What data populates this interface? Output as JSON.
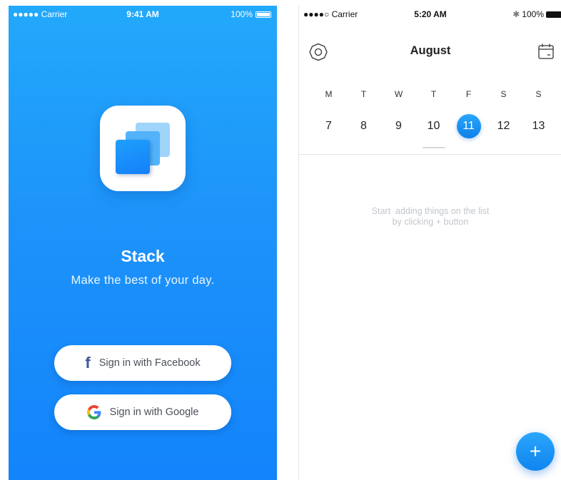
{
  "login_screen": {
    "status_bar": {
      "carrier": "●●●●● Carrier",
      "time": "9:41 AM",
      "battery": "100%"
    },
    "app_name": "Stack",
    "tagline": "Make the best of your day.",
    "facebook_button": {
      "label": "Sign in with Facebook",
      "icon": "facebook-icon"
    },
    "google_button": {
      "label": "Sign in with Google",
      "icon": "google-icon"
    },
    "colors": {
      "gradient_top": "#22a9fb",
      "gradient_bottom": "#1384fb",
      "facebook": "#3b5998"
    }
  },
  "calendar_screen": {
    "status_bar": {
      "carrier": "●●●●○ Carrier",
      "time": "5:20 AM",
      "battery": "100%"
    },
    "month": "August",
    "weekdays": [
      "M",
      "T",
      "W",
      "T",
      "F",
      "S",
      "S"
    ],
    "dates": [
      "7",
      "8",
      "9",
      "10",
      "11",
      "12",
      "13"
    ],
    "selected_date": "11",
    "empty_message_line1": "Start  adding things on the list",
    "empty_message_line2": "by clicking + button",
    "fab_label": "+",
    "colors": {
      "accent": "#1a90f5",
      "empty_text": "#c2c6cc"
    }
  }
}
